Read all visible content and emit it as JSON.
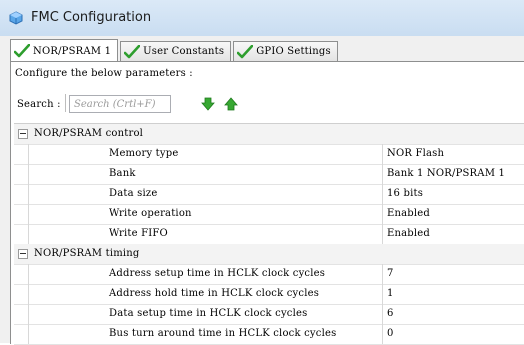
{
  "window": {
    "title": "FMC Configuration",
    "icon": "cube-icon"
  },
  "tabs": [
    {
      "label": "NOR/PSRAM 1",
      "icon": "checkmark-icon",
      "active": true
    },
    {
      "label": "User Constants",
      "icon": "checkmark-icon",
      "active": false
    },
    {
      "label": "GPIO Settings",
      "icon": "checkmark-icon",
      "active": false
    }
  ],
  "panel": {
    "hint": "Configure the below parameters :",
    "search": {
      "label": "Search :",
      "placeholder": "Search (Crtl+F)"
    },
    "buttons": {
      "down": "arrow-down-icon",
      "up": "arrow-up-icon"
    }
  },
  "groups": [
    {
      "title": "NOR/PSRAM control",
      "params": [
        {
          "name": "Memory type",
          "value": "NOR Flash"
        },
        {
          "name": "Bank",
          "value": "Bank 1 NOR/PSRAM 1"
        },
        {
          "name": "Data size",
          "value": "16 bits"
        },
        {
          "name": "Write operation",
          "value": "Enabled"
        },
        {
          "name": "Write FIFO",
          "value": "Enabled"
        }
      ]
    },
    {
      "title": "NOR/PSRAM timing",
      "params": [
        {
          "name": "Address setup time in HCLK clock cycles",
          "value": "7"
        },
        {
          "name": "Address hold time in HCLK clock cycles",
          "value": "1"
        },
        {
          "name": "Data setup time in HCLK clock cycles",
          "value": "6"
        },
        {
          "name": "Bus turn around time in HCLK clock cycles",
          "value": "0"
        }
      ]
    }
  ],
  "colors": {
    "check": "#2e9e2e",
    "arrows": "#37a832",
    "titlebar": "#d2e3f5"
  }
}
